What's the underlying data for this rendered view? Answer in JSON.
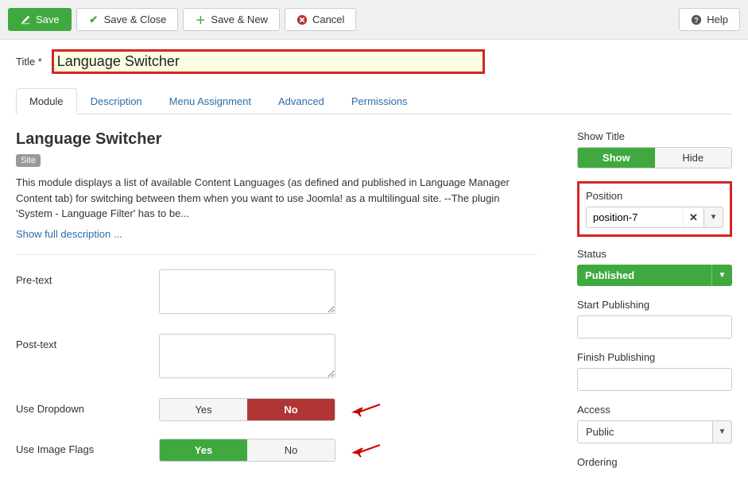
{
  "toolbar": {
    "save": "Save",
    "save_close": "Save & Close",
    "save_new": "Save & New",
    "cancel": "Cancel",
    "help": "Help"
  },
  "title_label": "Title *",
  "title_value": "Language Switcher",
  "tabs": {
    "module": "Module",
    "description": "Description",
    "menu_assignment": "Menu Assignment",
    "advanced": "Advanced",
    "permissions": "Permissions"
  },
  "main": {
    "heading": "Language Switcher",
    "site_badge": "Site",
    "description": "This module displays a list of available Content Languages (as defined and published in Language Manager Content tab) for switching between them when you want to use Joomla! as a multilingual site. --The plugin 'System - Language Filter' has to be...",
    "show_full": "Show full description ...",
    "pre_text_label": "Pre-text",
    "post_text_label": "Post-text",
    "use_dropdown_label": "Use Dropdown",
    "use_image_flags_label": "Use Image Flags",
    "yes": "Yes",
    "no": "No"
  },
  "side": {
    "show_title_label": "Show Title",
    "show": "Show",
    "hide": "Hide",
    "position_label": "Position",
    "position_value": "position-7",
    "status_label": "Status",
    "status_value": "Published",
    "start_pub_label": "Start Publishing",
    "finish_pub_label": "Finish Publishing",
    "access_label": "Access",
    "access_value": "Public",
    "ordering_label": "Ordering"
  }
}
